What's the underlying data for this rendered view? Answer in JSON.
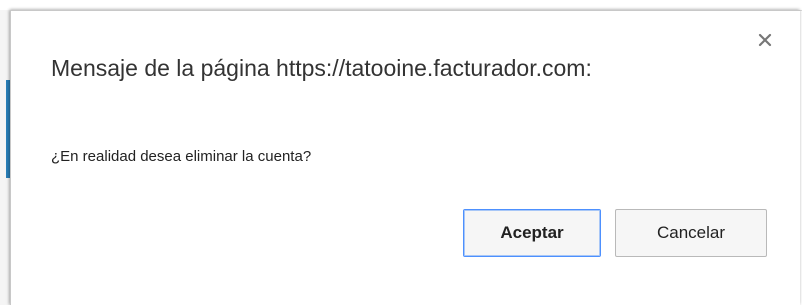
{
  "dialog": {
    "title": "Mensaje de la página https://tatooine.facturador.com:",
    "message": "¿En realidad desea eliminar la cuenta?",
    "close_icon": "close-icon",
    "buttons": {
      "ok_label": "Aceptar",
      "cancel_label": "Cancelar"
    }
  },
  "colors": {
    "accent": "#4d90fe",
    "background_accent": "#2a7fb8",
    "text": "#333333"
  }
}
